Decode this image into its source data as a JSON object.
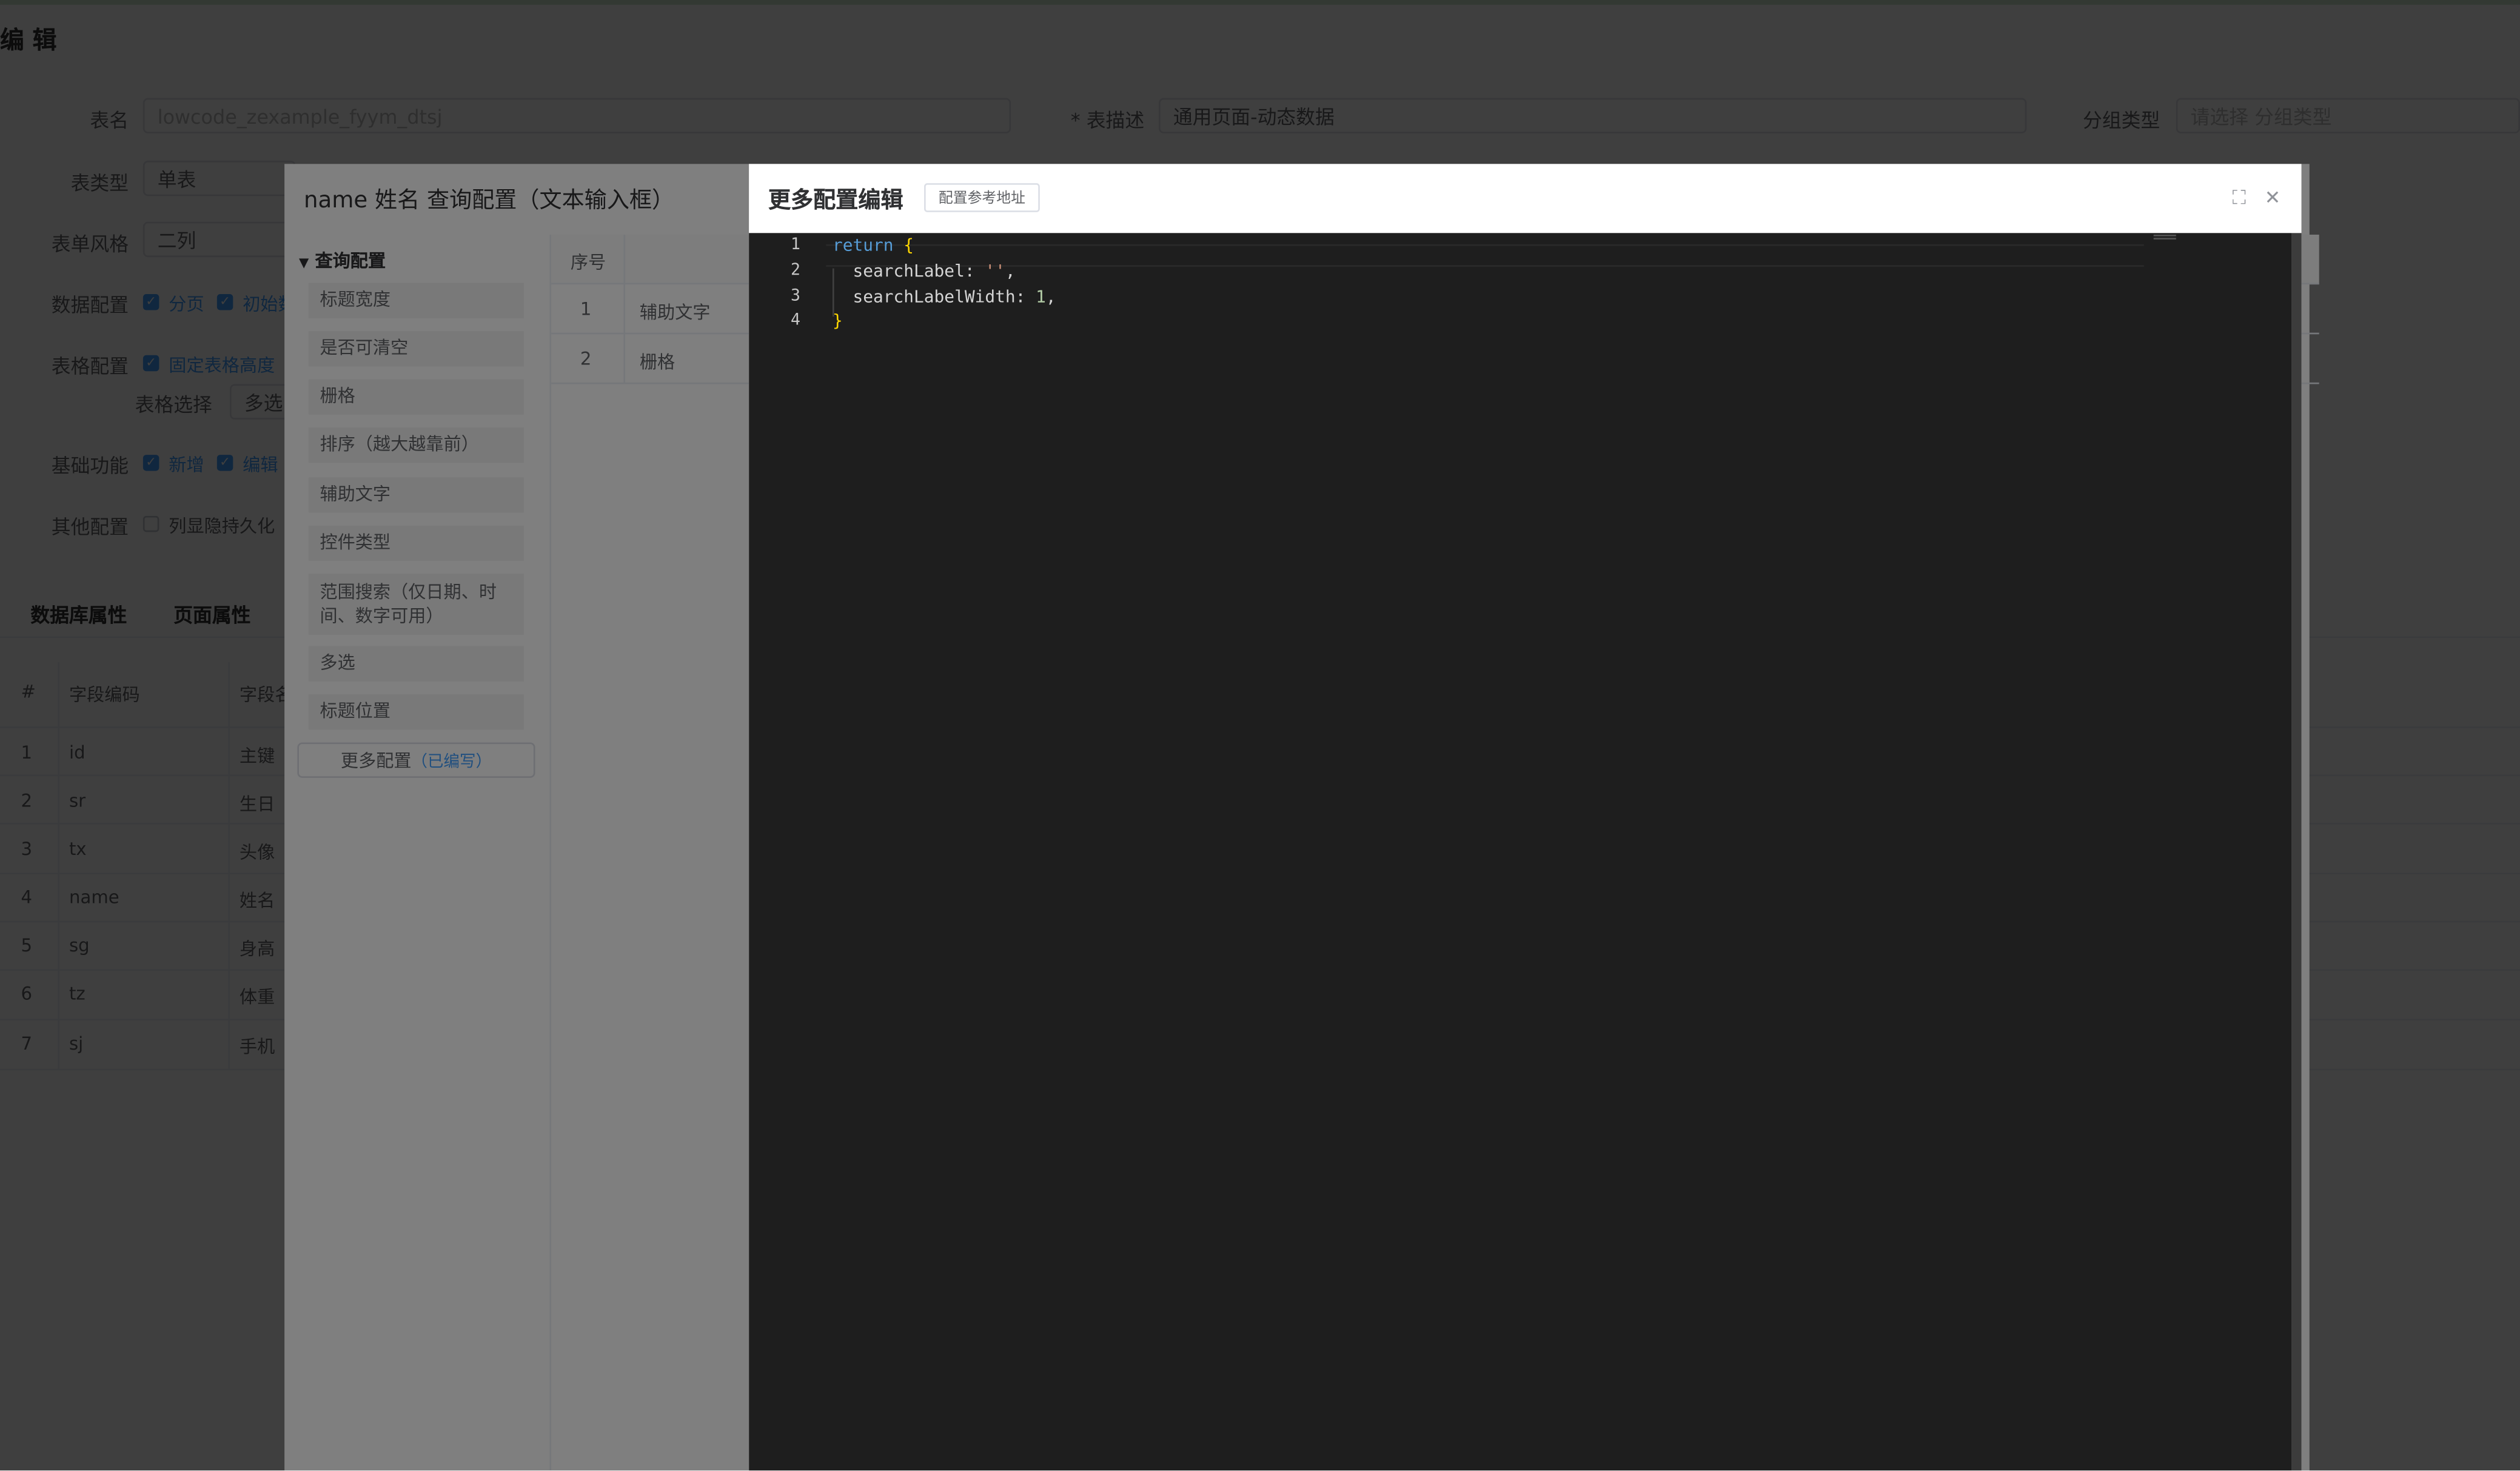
{
  "page": {
    "title": "编 辑",
    "form": {
      "table_name_label": "表名",
      "table_name_value": "lowcode_zexample_fyym_dtsj",
      "table_desc_label": "* 表描述",
      "table_desc_value": "通用页面-动态数据",
      "group_type_label": "分组类型",
      "group_type_placeholder": "请选择 分组类型",
      "table_type_label": "表类型",
      "table_type_value": "单表",
      "form_style_label": "表单风格",
      "form_style_value": "二列",
      "data_config_label": "数据配置",
      "data_config_items": [
        "分页",
        "初始数"
      ],
      "table_config_label": "表格配置",
      "table_config_item": "固定表格高度",
      "table_select_label": "表格选择",
      "table_select_value": "多选",
      "basic_func_label": "基础功能",
      "basic_func_items": [
        "新增",
        "编辑"
      ],
      "other_config_label": "其他配置",
      "other_config_item": "列显隐持久化"
    },
    "tabs": [
      "数据库属性",
      "页面属性"
    ],
    "table": {
      "headers": [
        "#",
        "字段编码",
        "字段名"
      ],
      "rows": [
        [
          "1",
          "id",
          "主键"
        ],
        [
          "2",
          "sr",
          "生日"
        ],
        [
          "3",
          "tx",
          "头像"
        ],
        [
          "4",
          "name",
          "姓名"
        ],
        [
          "5",
          "sg",
          "身高"
        ],
        [
          "6",
          "tz",
          "体重"
        ],
        [
          "7",
          "sj",
          "手机"
        ]
      ]
    }
  },
  "query_dialog": {
    "title": "name 姓名 查询配置（文本输入框）",
    "section": "查询配置",
    "items": [
      "标题宽度",
      "是否可清空",
      "栅格",
      "排序（越大越靠前）",
      "辅助文字",
      "控件类型",
      "范围搜索（仅日期、时间、数字可用）",
      "多选",
      "标题位置"
    ],
    "more_button": "更多配置",
    "more_tag": "（已编写）",
    "table_header": "序号",
    "table_rows": [
      [
        "1",
        "辅助文字"
      ],
      [
        "2",
        "栅格"
      ]
    ]
  },
  "more_dialog": {
    "title": "更多配置编辑",
    "ref_button": "配置参考地址",
    "fullscreen_icon": "⛶",
    "close_icon": "✕",
    "line_numbers": [
      "1",
      "2",
      "3",
      "4"
    ],
    "code": {
      "kw_return": "return",
      "open_brace": "{",
      "key1": "searchLabel:",
      "val1": "''",
      "key2": "searchLabelWidth:",
      "val2": "1",
      "comma": ",",
      "close_brace": "}"
    }
  },
  "colors": {
    "primary": "#409eff",
    "editor_bg": "#1e1e1e",
    "keyword": "#569cd6",
    "bracket": "#ffd700",
    "string": "#ce9178"
  }
}
